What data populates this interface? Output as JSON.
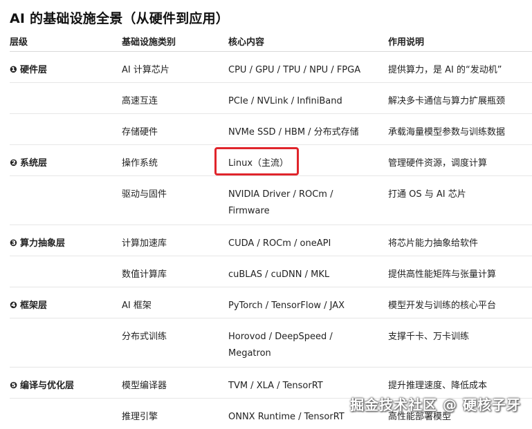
{
  "title": "AI 的基础设施全景（从硬件到应用）",
  "headers": {
    "layer": "层级",
    "category": "基础设施类别",
    "core": "核心内容",
    "description": "作用说明"
  },
  "rows": [
    {
      "layer_num": "❶",
      "layer": "硬件层",
      "category": "AI 计算芯片",
      "core": "CPU / GPU / TPU / NPU / FPGA",
      "description": "提供算力，是 AI 的“发动机”"
    },
    {
      "layer_num": "",
      "layer": "",
      "category": "高速互连",
      "core": "PCIe / NVLink / InfiniBand",
      "description": "解决多卡通信与算力扩展瓶颈"
    },
    {
      "layer_num": "",
      "layer": "",
      "category": "存储硬件",
      "core": "NVMe SSD / HBM / 分布式存储",
      "description": "承载海量模型参数与训练数据"
    },
    {
      "layer_num": "❷",
      "layer": "系统层",
      "category": "操作系统",
      "core": "Linux（主流）",
      "description": "管理硬件资源，调度计算"
    },
    {
      "layer_num": "",
      "layer": "",
      "category": "驱动与固件",
      "core": "NVIDIA Driver / ROCm / Firmware",
      "description": "打通 OS 与 AI 芯片"
    },
    {
      "layer_num": "❸",
      "layer": "算力抽象层",
      "category": "计算加速库",
      "core": "CUDA / ROCm / oneAPI",
      "description": "将芯片能力抽象给软件"
    },
    {
      "layer_num": "",
      "layer": "",
      "category": "数值计算库",
      "core": "cuBLAS / cuDNN / MKL",
      "description": "提供高性能矩阵与张量计算"
    },
    {
      "layer_num": "❹",
      "layer": "框架层",
      "category": "AI 框架",
      "core": "PyTorch / TensorFlow / JAX",
      "description": "模型开发与训练的核心平台"
    },
    {
      "layer_num": "",
      "layer": "",
      "category": "分布式训练",
      "core": "Horovod / DeepSpeed / Megatron",
      "description": "支撑千卡、万卡训练"
    },
    {
      "layer_num": "❺",
      "layer": "编译与优化层",
      "category": "模型编译器",
      "core": "TVM / XLA / TensorRT",
      "description": "提升推理速度、降低成本"
    },
    {
      "layer_num": "",
      "layer": "",
      "category": "推理引擎",
      "core": "ONNX Runtime / TensorRT",
      "description": "高性能部署模型"
    }
  ],
  "watermark": "掘金技术社区 @ 硬核子牙",
  "colors": {
    "highlight": "#e0242b",
    "divider": "#e6e6e6",
    "text": "#222222"
  }
}
